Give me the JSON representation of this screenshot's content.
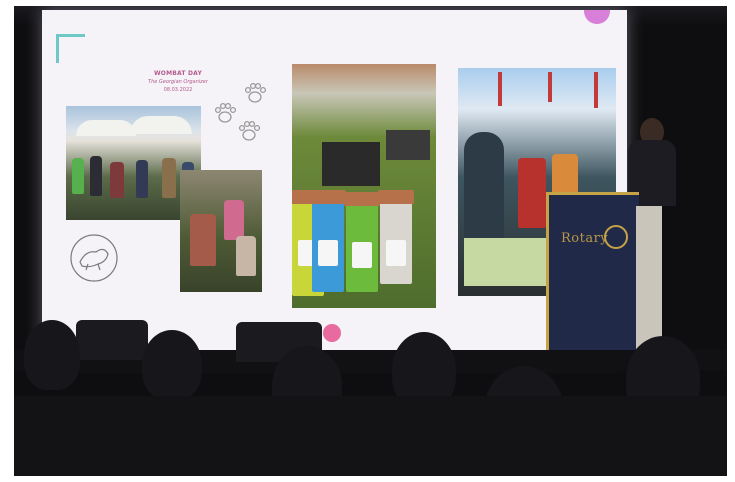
{
  "slide": {
    "title": "WOMBAT DAY",
    "subtitle": "The Georgian Organizer",
    "date": "08.03.2022"
  },
  "podium": {
    "brand": "Rotary"
  },
  "icons": [
    "paw-print-icon",
    "paw-print-icon",
    "paw-print-icon",
    "animal-outline-icon"
  ],
  "colors": {
    "screen": "#f5f3f7",
    "accent_teal": "#6ec9c6",
    "accent_pink": "#e86a9e",
    "accent_purple": "#d87fd9",
    "podium_blue": "#202a48",
    "podium_gold": "#c7a347"
  }
}
